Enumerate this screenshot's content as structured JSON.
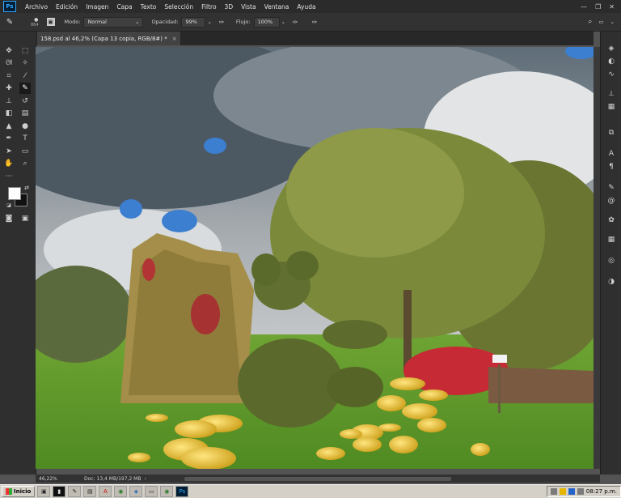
{
  "app": {
    "logo": "Ps"
  },
  "menu": [
    "Archivo",
    "Edición",
    "Imagen",
    "Capa",
    "Texto",
    "Selección",
    "Filtro",
    "3D",
    "Vista",
    "Ventana",
    "Ayuda"
  ],
  "window_controls": [
    "minimize-icon",
    "restore-icon",
    "close-icon"
  ],
  "options": {
    "brush_size": "864",
    "mode_label": "Modo:",
    "mode_value": "Normal",
    "opacity_label": "Opacidad:",
    "opacity_value": "99%",
    "flow_label": "Flujo:",
    "flow_value": "100%"
  },
  "document": {
    "tab_title": "158.psd al 46,2% (Capa 13 copia, RGB/8#) *",
    "close_label": "×"
  },
  "status": {
    "zoom": "46,22%",
    "doc_info": "Doc: 13,4 MB/197,2 MB",
    "arrow": "›"
  },
  "taskbar": {
    "start_label": "Inicio",
    "clock": "08:27 p.m.",
    "apps": [
      "explorer-icon",
      "cmd-icon",
      "paint-icon",
      "notes-icon",
      "acrobat-icon",
      "chrome-icon",
      "app-icon",
      "window-icon",
      "chrome-icon",
      "photoshop-icon"
    ]
  },
  "colors": {
    "foreground": "#ffffff",
    "background": "#111111",
    "accent": "#31a8ff"
  }
}
